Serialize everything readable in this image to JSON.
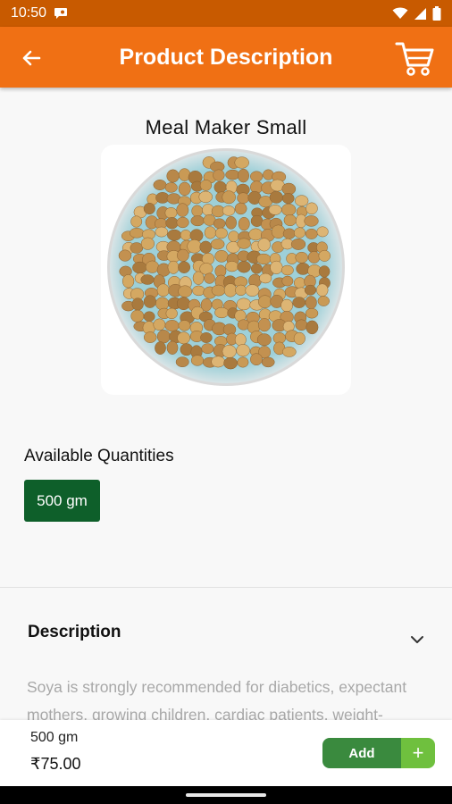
{
  "status_bar": {
    "time": "10:50",
    "icons": [
      "chat-notification-icon",
      "wifi-icon",
      "signal-icon",
      "battery-icon"
    ]
  },
  "app_bar": {
    "title": "Product Description",
    "back_icon": "arrow-left-icon",
    "cart_icon": "cart-icon",
    "color": "#f07014"
  },
  "product": {
    "name": "Meal Maker Small",
    "image": "soya-chunks-bowl"
  },
  "quantities": {
    "heading": "Available Quantities",
    "options": [
      "500 gm"
    ],
    "selected": "500 gm",
    "selected_color": "#0e5f2a"
  },
  "description": {
    "heading": "Description",
    "toggle_icon": "chevron-down-icon",
    "text": "Soya is strongly recommended for diabetics, expectant mothers, growing children, cardiac patients, weight-"
  },
  "bottom_bar": {
    "quantity": "500 gm",
    "price": "₹75.00",
    "add_label": "Add",
    "plus_label": "+"
  }
}
